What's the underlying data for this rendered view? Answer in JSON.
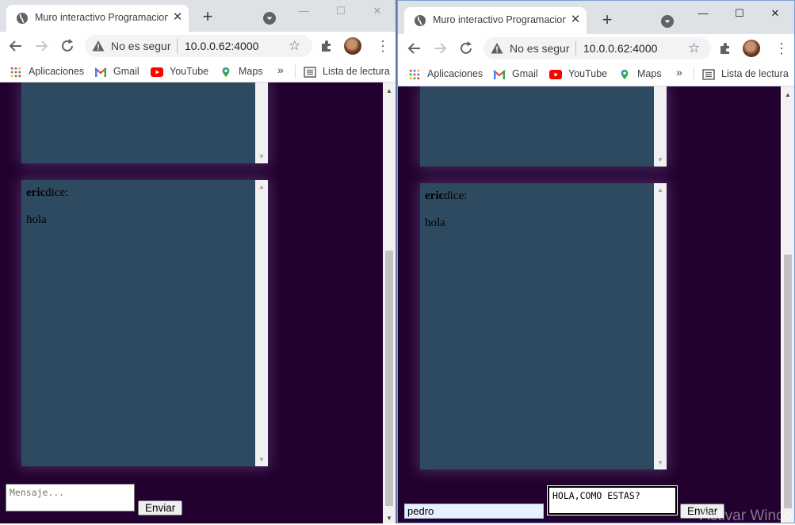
{
  "windows": {
    "left": {
      "tab_title": "Muro interactivo Programacion",
      "security_label": "No es segur",
      "url": "10.0.0.62:4000",
      "post_author": "eric",
      "post_says": "dice:",
      "post_text": "hola",
      "message_placeholder": "Mensaje...",
      "message_value": "",
      "send_label": "Enviar"
    },
    "right": {
      "tab_title": "Muro interactivo Programacion",
      "security_label": "No es segur",
      "url": "10.0.0.62:4000",
      "post_author": "eric",
      "post_says": "dice:",
      "post_text": "hola",
      "name_value": "pedro",
      "message_placeholder": "Mensaje...",
      "message_value": "HOLA,COMO ESTAS?",
      "send_label": "Enviar"
    }
  },
  "bookmarks": {
    "apps": "Aplicaciones",
    "gmail": "Gmail",
    "youtube": "YouTube",
    "maps": "Maps",
    "more": "»",
    "reading_list": "Lista de lectura"
  },
  "window_controls": {
    "minimize": "—",
    "maximize": "☐",
    "close": "✕"
  },
  "icons": {
    "tab_close": "✕",
    "new_tab": "+",
    "star": "☆",
    "menu": "⋮"
  },
  "watermark": "Activar Windo",
  "colors": {
    "page_background": "#22002f",
    "card_background": "#2e4a61",
    "tab_strip": "#dee1e6"
  }
}
